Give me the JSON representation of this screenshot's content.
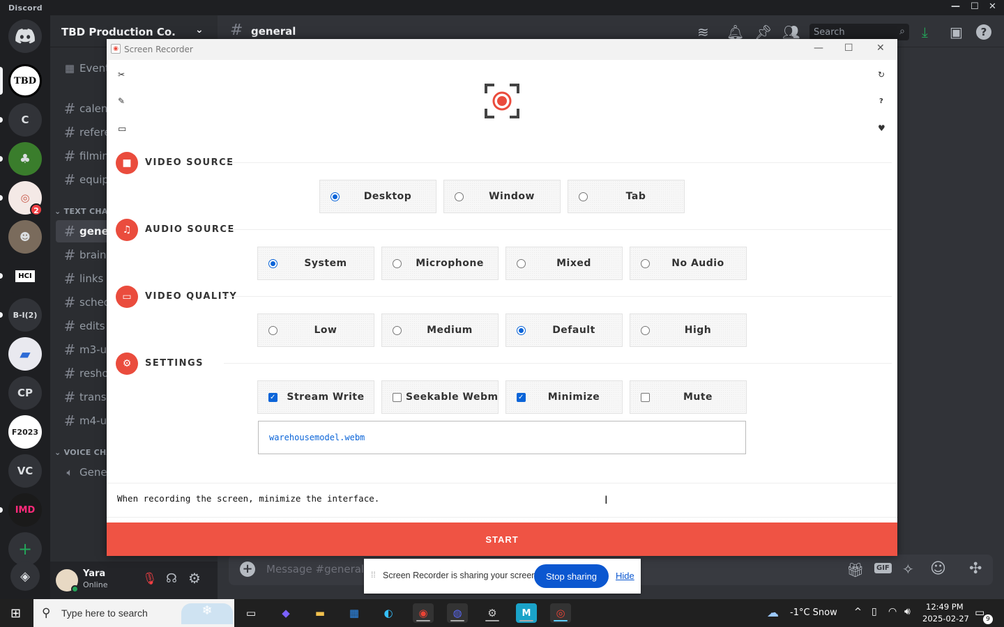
{
  "discord": {
    "title": "Discord",
    "guild_name": "TBD Production Co.",
    "channel_name": "general",
    "search_placeholder": "Search",
    "servers": [
      {
        "label": "C"
      },
      {
        "label": "HCI"
      },
      {
        "label": "B-I(2)"
      },
      {
        "label": "CP"
      },
      {
        "label": "F2023"
      },
      {
        "label": "VC"
      },
      {
        "label": "IMD"
      }
    ],
    "server_badge": "2",
    "events_label": "Event",
    "channels_top": [
      "calen",
      "refere",
      "filmin",
      "equip"
    ],
    "text_category": "TEXT CHAN",
    "channels_text": [
      "gener",
      "brains",
      "links",
      "sched",
      "edits",
      "m3-u",
      "resho",
      "transi",
      "m4-u"
    ],
    "voice_category": "VOICE CHA",
    "voice_channel": "Gener",
    "user": {
      "name": "Yara",
      "status": "Online"
    },
    "message_placeholder": "Message #general"
  },
  "recorder": {
    "window_title": "Screen Recorder",
    "sections": {
      "video_source": {
        "title": "VIDEO SOURCE",
        "options": [
          {
            "label": "Desktop",
            "selected": true
          },
          {
            "label": "Window",
            "selected": false
          },
          {
            "label": "Tab",
            "selected": false
          }
        ]
      },
      "audio_source": {
        "title": "AUDIO SOURCE",
        "options": [
          {
            "label": "System",
            "selected": true
          },
          {
            "label": "Microphone",
            "selected": false
          },
          {
            "label": "Mixed",
            "selected": false
          },
          {
            "label": "No Audio",
            "selected": false
          }
        ]
      },
      "video_quality": {
        "title": "VIDEO QUALITY",
        "options": [
          {
            "label": "Low",
            "selected": false
          },
          {
            "label": "Medium",
            "selected": false
          },
          {
            "label": "Default",
            "selected": true
          },
          {
            "label": "High",
            "selected": false
          }
        ]
      },
      "settings": {
        "title": "SETTINGS",
        "options": [
          {
            "label": "Stream Write",
            "checked": true
          },
          {
            "label": "Seekable Webm",
            "checked": false
          },
          {
            "label": "Minimize",
            "checked": true
          },
          {
            "label": "Mute",
            "checked": false
          }
        ]
      }
    },
    "filename": "warehousemodel.webm",
    "hint": "When recording the screen, minimize the interface.",
    "start_label": "START",
    "accent_color": "#ea4c3d"
  },
  "sharing_bar": {
    "message": "Screen Recorder is sharing your screen.",
    "stop_label": "Stop sharing",
    "hide_label": "Hide"
  },
  "taskbar": {
    "search_placeholder": "Type here to search",
    "weather": "-1°C  Snow",
    "time": "12:49 PM",
    "date": "2025-02-27",
    "notifications": "9"
  }
}
